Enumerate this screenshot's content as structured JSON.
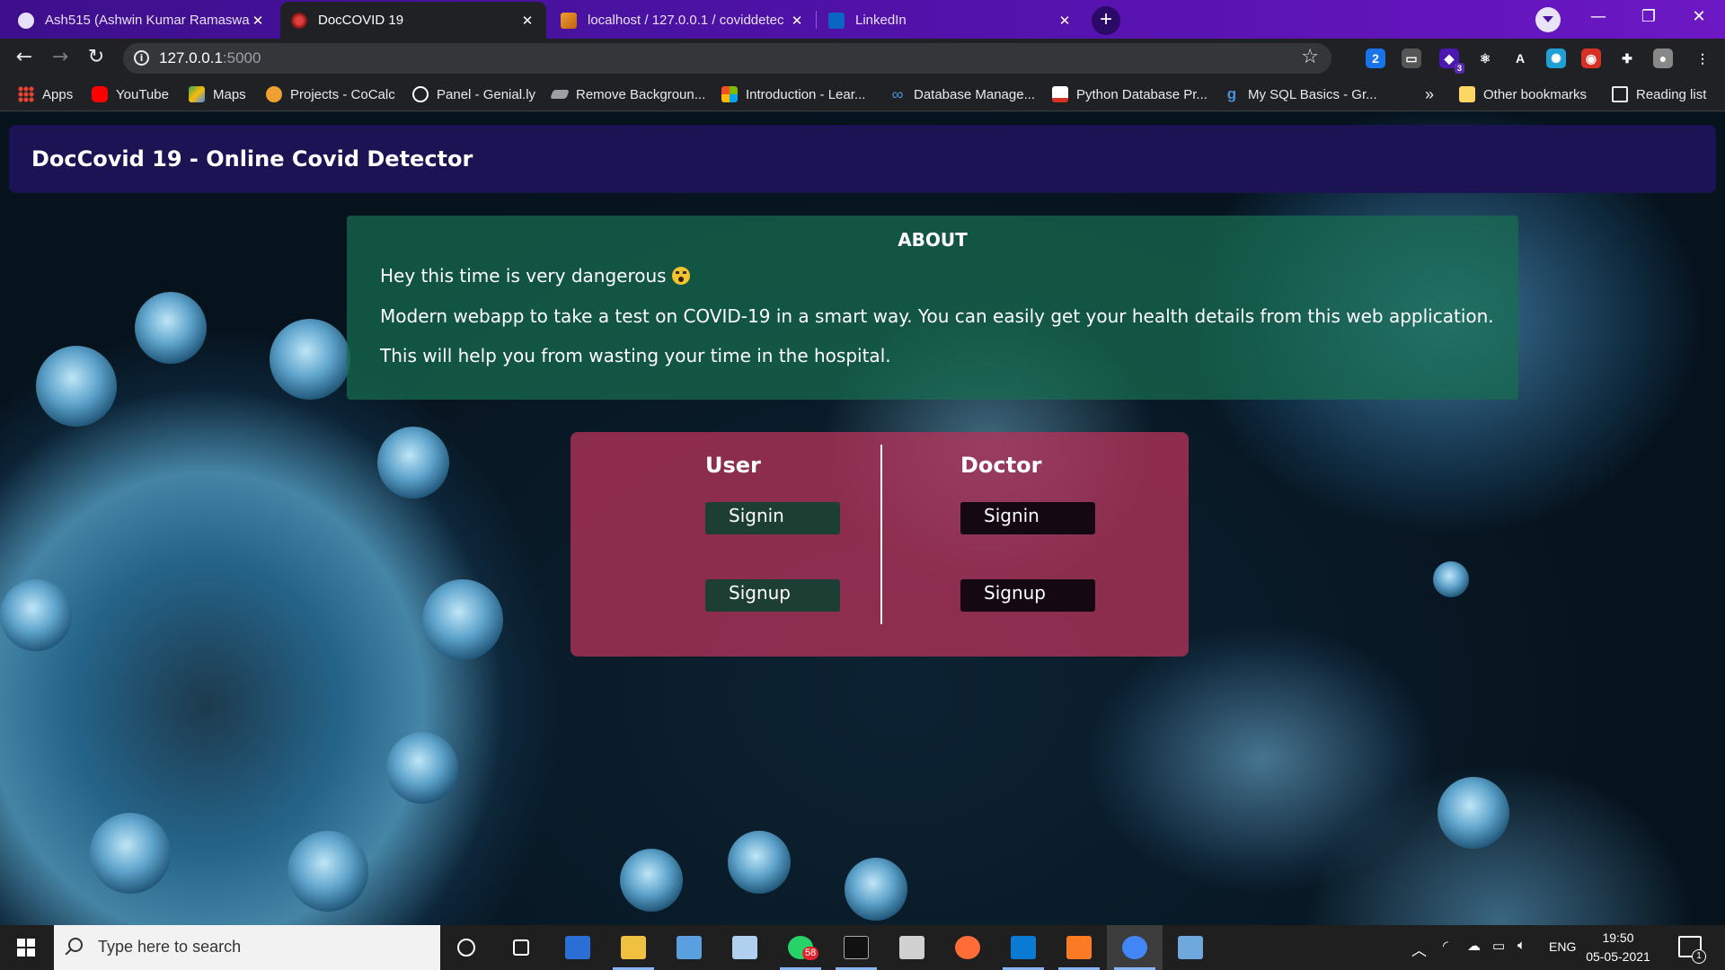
{
  "browser": {
    "tabs": [
      {
        "label": "Ash515 (Ashwin Kumar Ramaswa",
        "active": false,
        "icon": "github-icon"
      },
      {
        "label": "DocCOVID 19",
        "active": true,
        "icon": "virus-icon"
      },
      {
        "label": "localhost / 127.0.0.1 / coviddetec",
        "active": false,
        "icon": "phpmyadmin-icon"
      },
      {
        "label": "LinkedIn",
        "active": false,
        "icon": "linkedin-icon"
      }
    ],
    "new_tab": "+",
    "url_host": "127.0.0.1",
    "url_port": ":5000",
    "window_controls": {
      "minimize": "—",
      "restore": "❐",
      "close": "✕"
    },
    "extensions": [
      {
        "name": "ext-2-icon",
        "text": "2",
        "color": "#1a73e8"
      },
      {
        "name": "ext-screenshot-icon",
        "text": "▭",
        "color": "#555555"
      },
      {
        "name": "ext-polygon-icon",
        "text": "◆",
        "color": "#4b18b0",
        "badge": "3"
      },
      {
        "name": "ext-react-icon",
        "text": "⚛",
        "color": "#202124"
      },
      {
        "name": "ext-a-icon",
        "text": "A",
        "color": "#202124"
      },
      {
        "name": "ext-sun-icon",
        "text": "✺",
        "color": "#1f9fd4"
      },
      {
        "name": "ext-color-icon",
        "text": "◉",
        "color": "#d93025"
      },
      {
        "name": "extensions-puzzle-icon",
        "text": "✚",
        "color": "#202124"
      },
      {
        "name": "profile-avatar-icon",
        "text": "●",
        "color": "#888888"
      },
      {
        "name": "chrome-menu-icon",
        "text": "⋮",
        "color": "#202124"
      }
    ]
  },
  "bookmarks": {
    "items": [
      {
        "label": "Apps",
        "icon": "apps-grid-icon",
        "color": "#ea4335"
      },
      {
        "label": "YouTube",
        "icon": "youtube-icon",
        "color": "#ff0000"
      },
      {
        "label": "Maps",
        "icon": "maps-icon",
        "color": "#34a853"
      },
      {
        "label": "Projects - CoCalc",
        "icon": "cocalc-icon",
        "color": "#f0a030"
      },
      {
        "label": "Panel - Genial.ly",
        "icon": "genially-icon",
        "color": "#ffffff"
      },
      {
        "label": "Remove Backgroun...",
        "icon": "removebg-icon",
        "color": "#9aa0a6"
      },
      {
        "label": "Introduction - Lear...",
        "icon": "microsoft-icon",
        "color": "#f25022"
      },
      {
        "label": "Database Manage...",
        "icon": "infinity-icon",
        "color": "#4a90d9"
      },
      {
        "label": "Python Database Pr...",
        "icon": "pdf-icon",
        "color": "#d93025"
      },
      {
        "label": "My SQL Basics - Gr...",
        "icon": "gfg-icon",
        "color": "#4a90d9"
      }
    ],
    "overflow": "»",
    "other": "Other bookmarks",
    "reading_list": "Reading list"
  },
  "page": {
    "title": "DocCovid 19 - Online Covid Detector",
    "about": {
      "heading": "ABOUT",
      "line1": "Hey this time is very dangerous",
      "line2": "Modern webapp to take a test on COVID-19 in a smart way. You can easily get your health details from this web application.",
      "line3": "This will help you from wasting your time in the hospital."
    },
    "user": {
      "heading": "User",
      "signin": "Signin",
      "signup": "Signup"
    },
    "doctor": {
      "heading": "Doctor",
      "signin": "Signin",
      "signup": "Signup"
    },
    "colors": {
      "header": "#1b1353",
      "about": "#186e50",
      "card": "#b23258",
      "user_button": "#1d3f33",
      "doctor_button": "#140912"
    }
  },
  "taskbar": {
    "search_placeholder": "Type here to search",
    "apps": [
      {
        "name": "cortana-icon",
        "running": false
      },
      {
        "name": "task-view-icon",
        "running": false
      },
      {
        "name": "store-icon",
        "running": false
      },
      {
        "name": "file-explorer-icon",
        "running": true
      },
      {
        "name": "notepad-icon",
        "running": false
      },
      {
        "name": "paint-icon",
        "running": false
      },
      {
        "name": "whatsapp-icon",
        "running": true,
        "badge": "58"
      },
      {
        "name": "terminal-icon",
        "running": true
      },
      {
        "name": "git-icon",
        "running": false
      },
      {
        "name": "postman-icon",
        "running": false
      },
      {
        "name": "vscode-icon",
        "running": true
      },
      {
        "name": "xampp-icon",
        "running": true
      },
      {
        "name": "chrome-icon",
        "running": true,
        "active": true
      },
      {
        "name": "network-manager-icon",
        "running": false
      }
    ],
    "language": "ENG",
    "time": "19:50",
    "date": "05-05-2021",
    "notifications": "1"
  }
}
